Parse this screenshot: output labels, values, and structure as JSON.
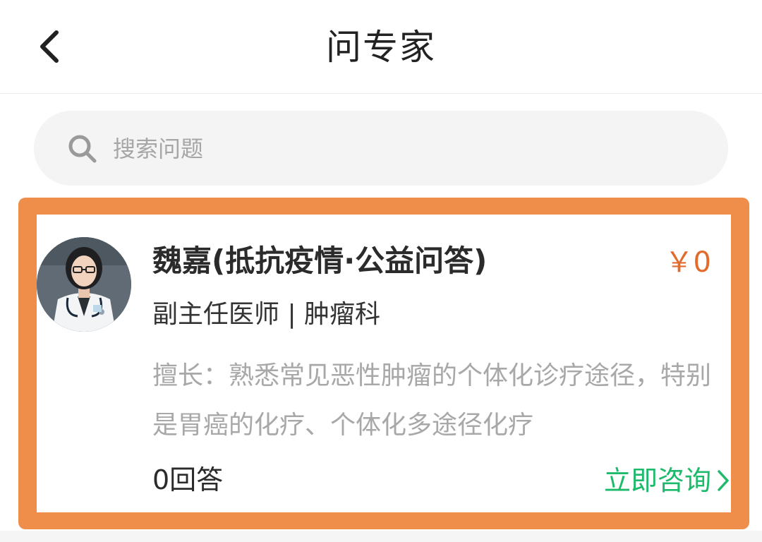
{
  "header": {
    "title": "问专家",
    "back_icon": "chevron-left-icon"
  },
  "search": {
    "placeholder": "搜索问题",
    "value": "",
    "icon": "search-icon"
  },
  "expert": {
    "name": "魏嘉(抵抗疫情·公益问答)",
    "price": "￥0",
    "title_dept": "副主任医师 | 肿瘤科",
    "expertise": "擅长：熟悉常见恶性肿瘤的个体化诊疗途径，特别是胃癌的化疗、个体化多途径化疗",
    "answers": "0回答",
    "consult_label": "立即咨询"
  },
  "colors": {
    "accent_green": "#1dba6b",
    "price_orange": "#e26a2c",
    "highlight_border": "#ef8e4a"
  }
}
